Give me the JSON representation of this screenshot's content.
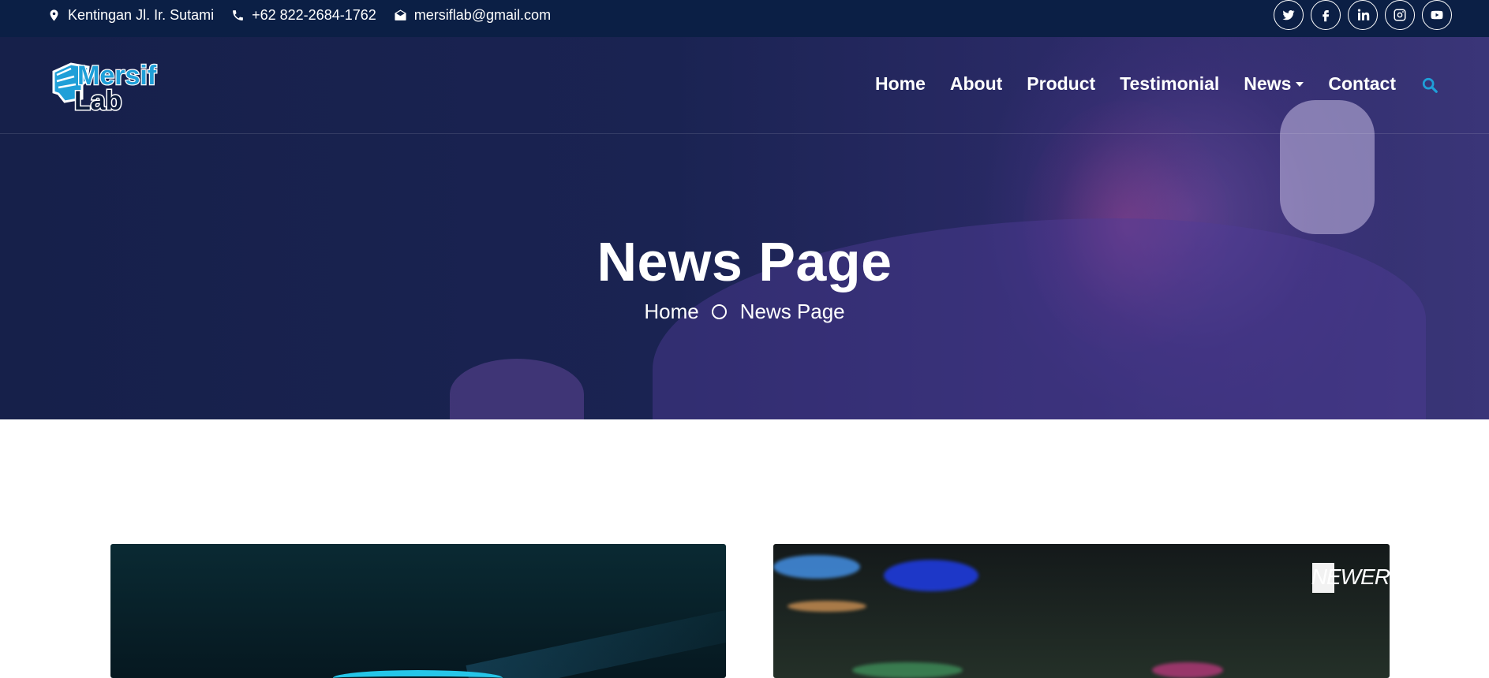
{
  "topbar": {
    "address": "Kentingan Jl. Ir. Sutami",
    "phone": "+62 822-2684-1762",
    "email": "mersiflab@gmail.com",
    "social": [
      "twitter-icon",
      "facebook-icon",
      "linkedin-icon",
      "instagram-icon",
      "youtube-icon"
    ]
  },
  "brand": {
    "logo_line1": "Mersif",
    "logo_line2": "Lab"
  },
  "nav": {
    "items": [
      "Home",
      "About",
      "Product",
      "Testimonial",
      "News",
      "Contact"
    ],
    "search_icon": "search-icon"
  },
  "hero": {
    "title": "News Page",
    "breadcrumb": [
      "Home",
      "News Page"
    ]
  },
  "cards": {
    "card2_brand": "NEWER"
  },
  "colors": {
    "topbar": "#0b1f45",
    "accent": "#1f9fd8",
    "hero_overlay": "#1a2352"
  }
}
